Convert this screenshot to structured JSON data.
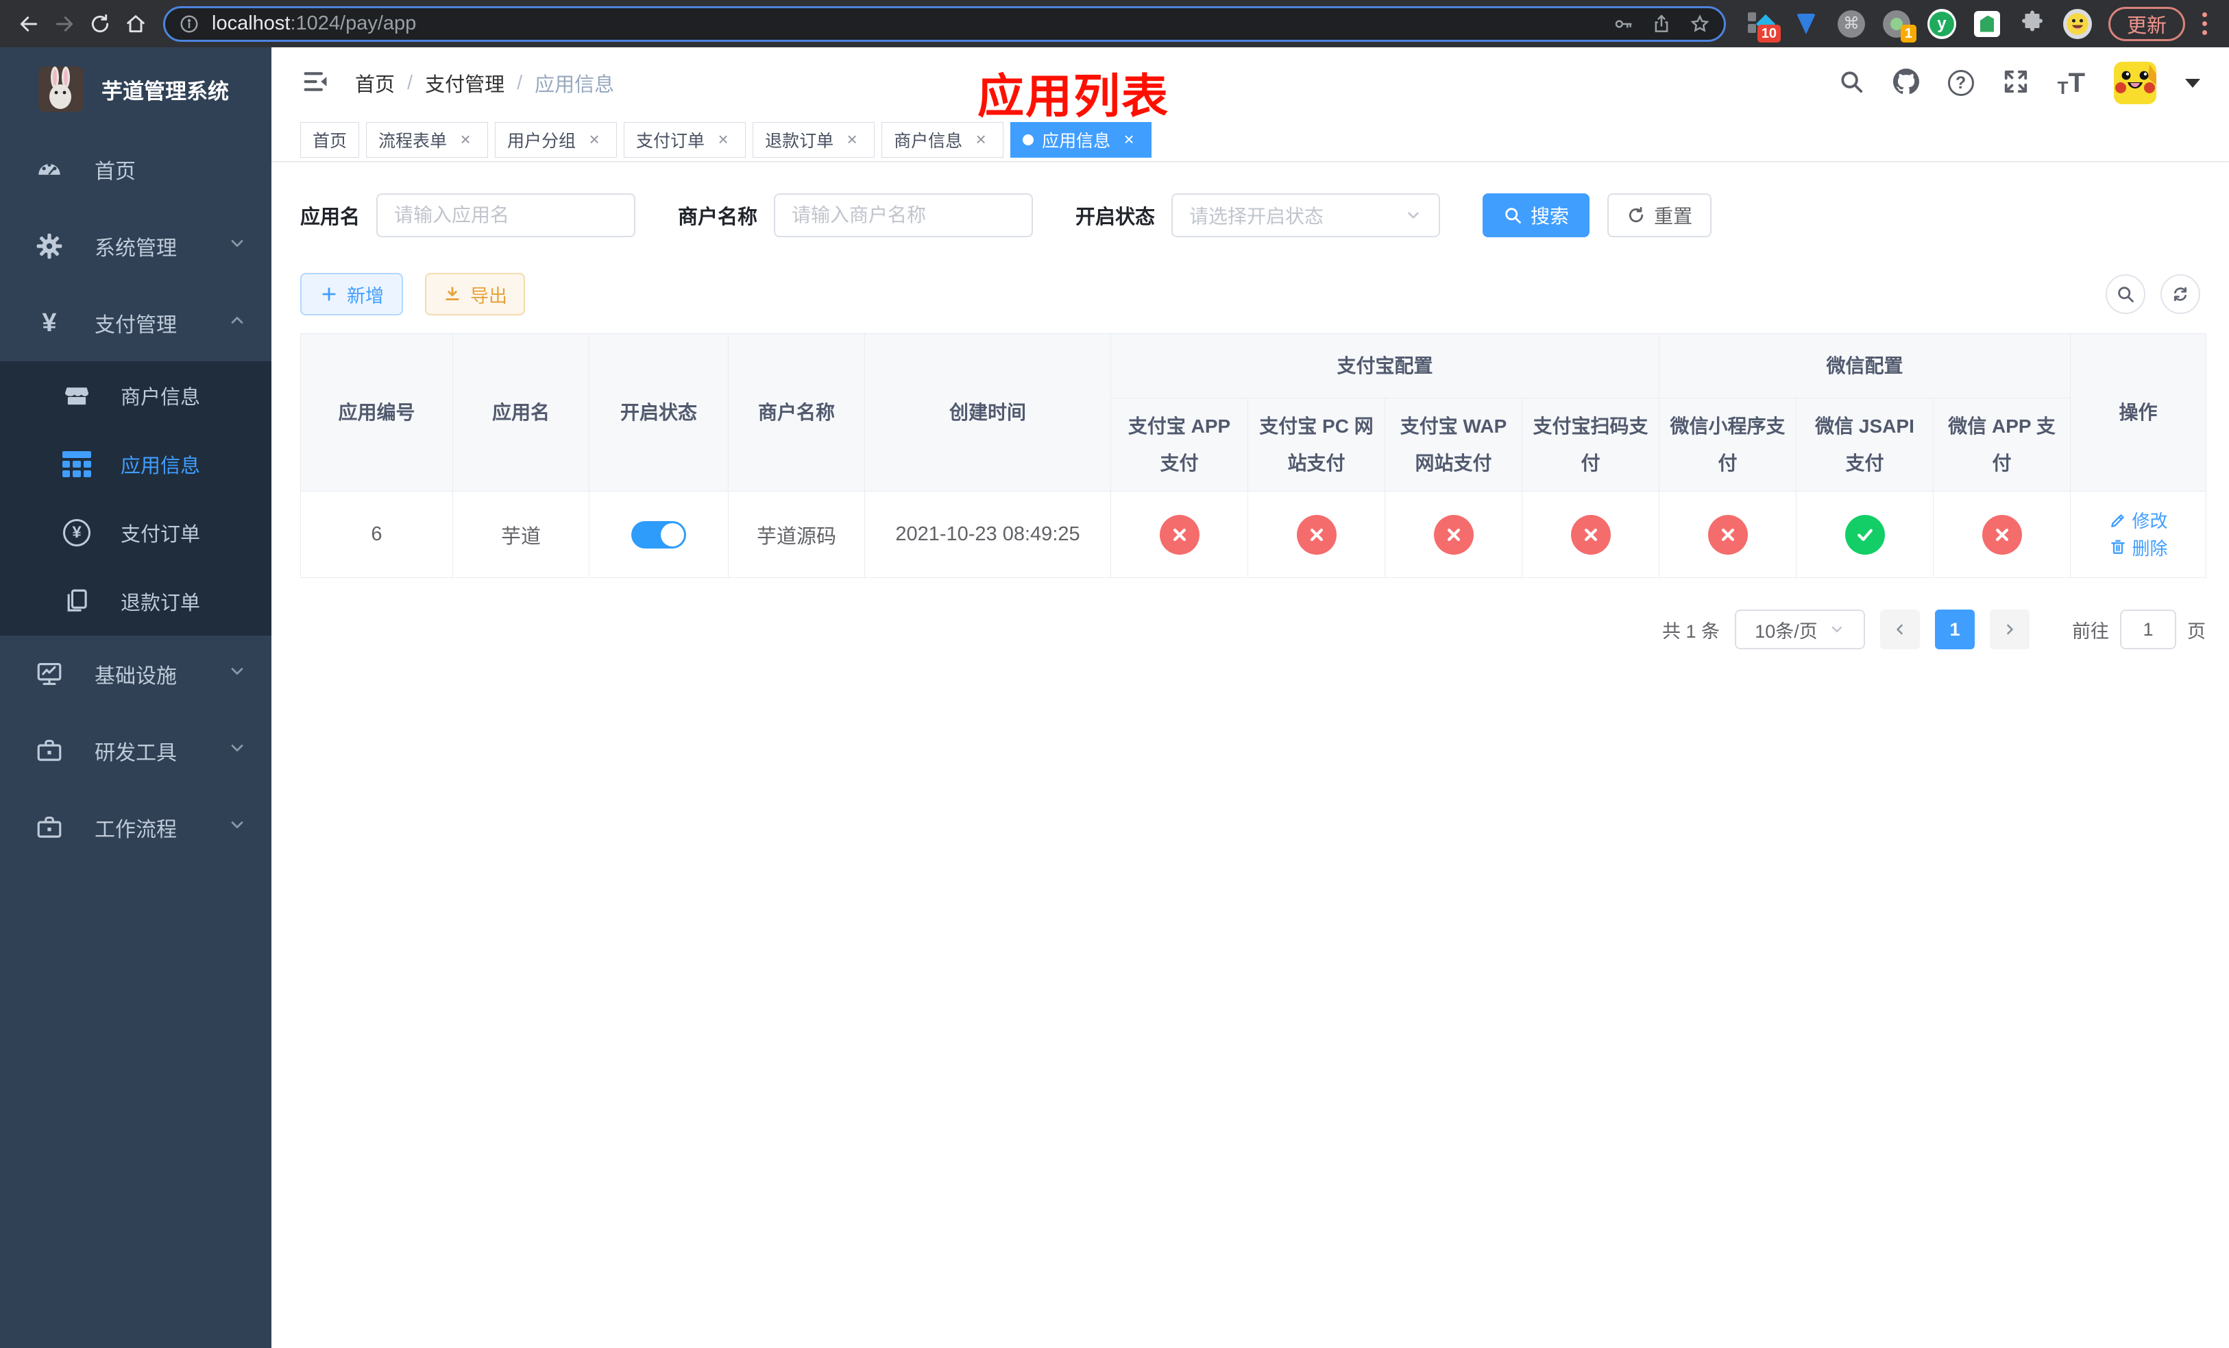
{
  "colors": {
    "primary": "#409eff",
    "success": "#13ce66",
    "danger": "#f56c6c",
    "warning": "#e6a23c",
    "annotation_red": "#fd1000"
  },
  "icons": {
    "close": "×",
    "yen": "¥",
    "question": "?",
    "command": "⌘"
  },
  "browser": {
    "url_host": "localhost",
    "url_path": ":1024/pay/app",
    "update_button": "更新",
    "badges": {
      "extension_a": "10",
      "extension_b": "1"
    },
    "extension_y_label": "y"
  },
  "sidebar": {
    "logo_title": "芋道管理系统",
    "menu": [
      {
        "label": "首页"
      },
      {
        "label": "系统管理"
      },
      {
        "label": "支付管理"
      },
      {
        "label": "商户信息"
      },
      {
        "label": "应用信息"
      },
      {
        "label": "支付订单"
      },
      {
        "label": "退款订单"
      },
      {
        "label": "基础设施"
      },
      {
        "label": "研发工具"
      },
      {
        "label": "工作流程"
      }
    ]
  },
  "header": {
    "breadcrumb": {
      "items": [
        "首页",
        "支付管理",
        "应用信息"
      ],
      "separator": "/"
    },
    "annotation": "应用列表"
  },
  "tabs": [
    {
      "label": "首页"
    },
    {
      "label": "流程表单"
    },
    {
      "label": "用户分组"
    },
    {
      "label": "支付订单"
    },
    {
      "label": "退款订单"
    },
    {
      "label": "商户信息"
    },
    {
      "label": "应用信息"
    }
  ],
  "filters": {
    "app_name_label": "应用名",
    "app_name_placeholder": "请输入应用名",
    "merchant_label": "商户名称",
    "merchant_placeholder": "请输入商户名称",
    "status_label": "开启状态",
    "status_placeholder": "请选择开启状态",
    "search_button": "搜索",
    "reset_button": "重置"
  },
  "toolbar": {
    "add_button": "新增",
    "export_button": "导出"
  },
  "table": {
    "headers": {
      "app_id": "应用编号",
      "app_name": "应用名",
      "status": "开启状态",
      "merchant": "商户名称",
      "created": "创建时间",
      "alipay_group": "支付宝配置",
      "wechat_group": "微信配置",
      "alipay_app": "支付宝 APP 支付",
      "alipay_pc": "支付宝 PC 网站支付",
      "alipay_wap": "支付宝 WAP 网站支付",
      "alipay_qr": "支付宝扫码支付",
      "wechat_mini": "微信小程序支付",
      "wechat_jsapi": "微信 JSAPI 支付",
      "wechat_app": "微信 APP 支付",
      "actions": "操作"
    },
    "row": {
      "app_id": "6",
      "app_name": "芋道",
      "enabled": true,
      "merchant": "芋道源码",
      "created": "2021-10-23 08:49:25",
      "configs": [
        false,
        false,
        false,
        false,
        false,
        true,
        false
      ],
      "edit_link": "修改",
      "delete_link": "删除"
    }
  },
  "pagination": {
    "total": "共 1 条",
    "page_size": "10条/页",
    "current_page": "1",
    "goto_prefix": "前往",
    "goto_page": "1",
    "goto_suffix": "页"
  }
}
